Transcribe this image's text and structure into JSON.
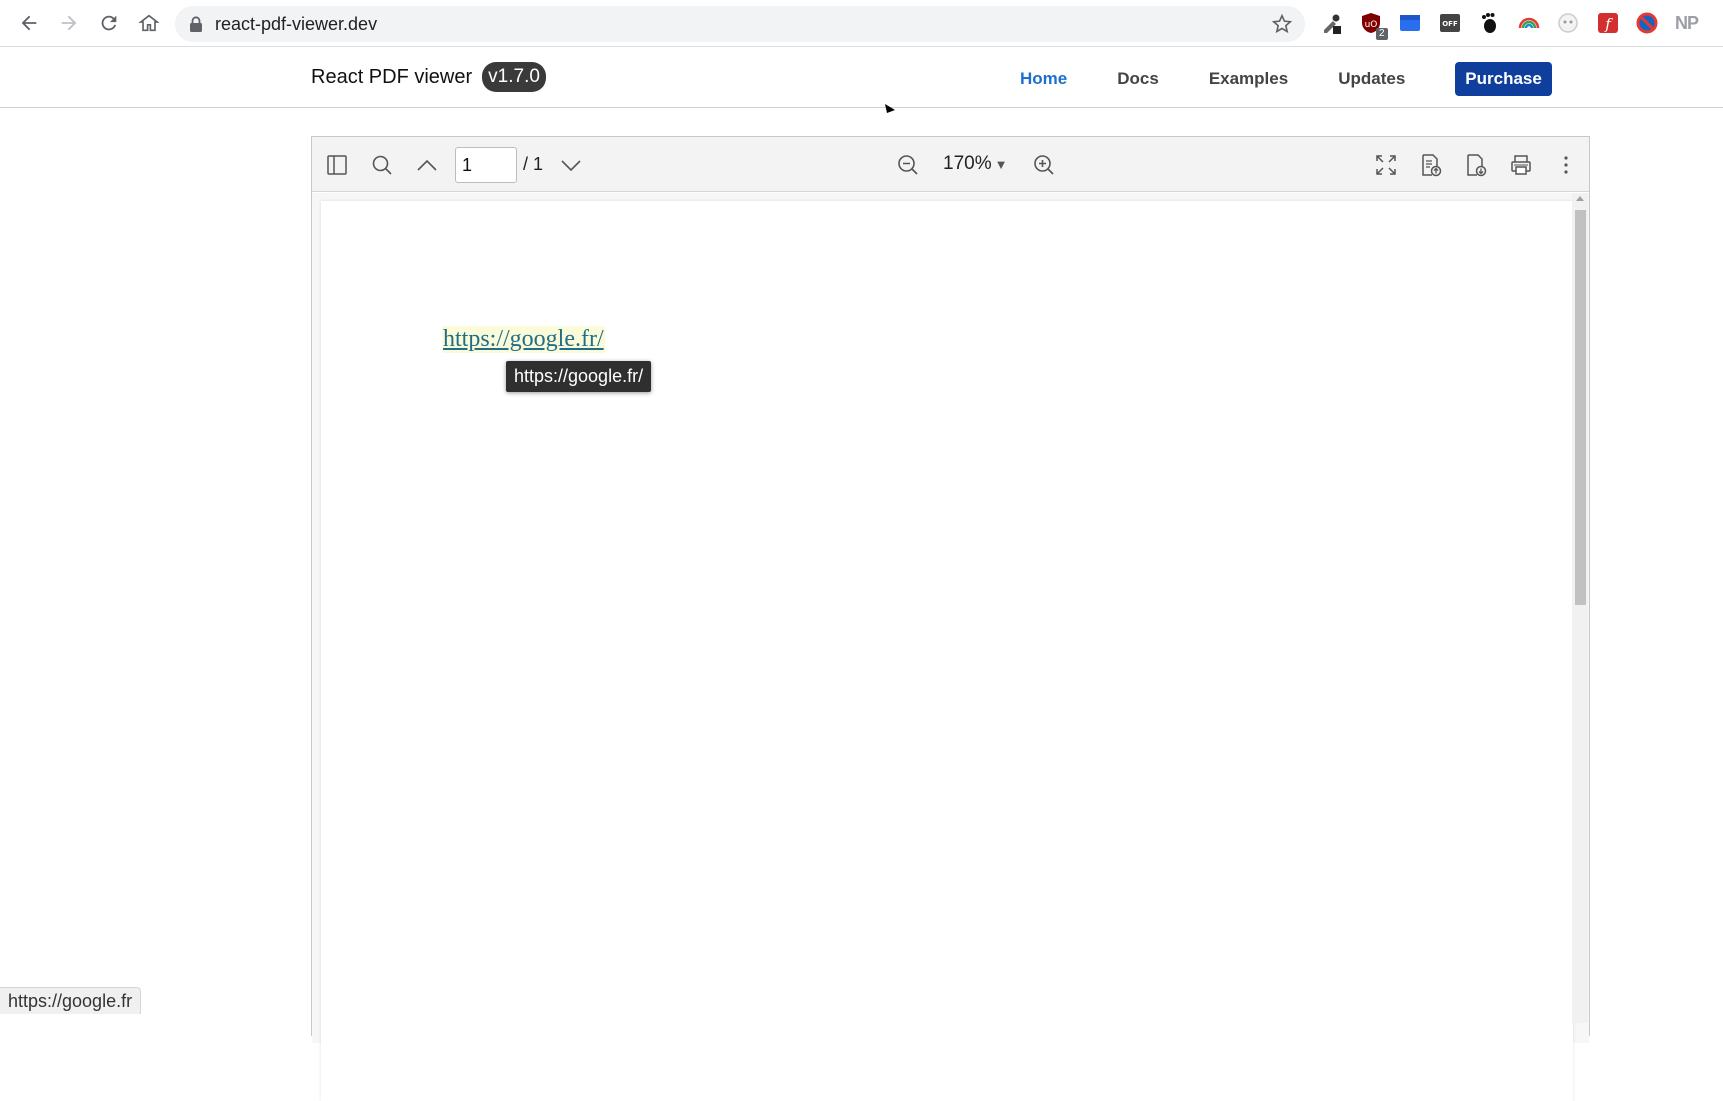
{
  "browser": {
    "url": "react-pdf-viewer.dev",
    "extensions": [
      {
        "name": "eyedropper-extension",
        "badge": ""
      },
      {
        "name": "ublock-extension",
        "badge": "2"
      },
      {
        "name": "blue-extension",
        "badge": ""
      },
      {
        "name": "off-extension",
        "badge": ""
      },
      {
        "name": "gnome-extension",
        "badge": ""
      },
      {
        "name": "rainbow-extension",
        "badge": ""
      },
      {
        "name": "circle-extension",
        "badge": ""
      },
      {
        "name": "f-extension",
        "badge": ""
      },
      {
        "name": "blocked-extension",
        "badge": ""
      },
      {
        "name": "np-extension",
        "badge": ""
      }
    ],
    "np_label": "NP",
    "status_url": "https://google.fr"
  },
  "site": {
    "title": "React PDF viewer",
    "version": "v1.7.0",
    "nav": {
      "home": "Home",
      "docs": "Docs",
      "examples": "Examples",
      "updates": "Updates",
      "purchase": "Purchase"
    }
  },
  "viewer": {
    "current_page": "1",
    "total_pages": "/ 1",
    "zoom": "170%",
    "link_text": "https://google.fr/",
    "tooltip": "https://google.fr/"
  },
  "colors": {
    "accent": "#1e6fd0",
    "purchase_bg": "#0f3e9c",
    "link": "#1f6f8b"
  }
}
